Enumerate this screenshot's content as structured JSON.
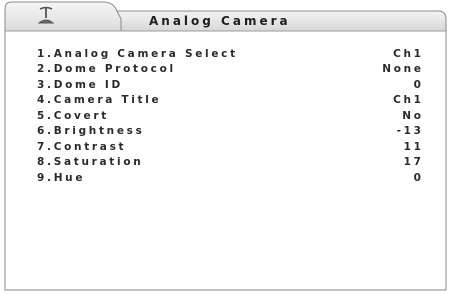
{
  "window": {
    "title": "Analog Camera",
    "icon": "antenna-icon"
  },
  "menu": {
    "items": [
      {
        "label": "1.Analog Camera Select",
        "value": "Ch1"
      },
      {
        "label": "2.Dome Protocol",
        "value": "None"
      },
      {
        "label": "3.Dome ID",
        "value": "0"
      },
      {
        "label": "4.Camera Title",
        "value": "Ch1"
      },
      {
        "label": "5.Covert",
        "value": "No"
      },
      {
        "label": "6.Brightness",
        "value": "-13"
      },
      {
        "label": "7.Contrast",
        "value": "11"
      },
      {
        "label": "8.Saturation",
        "value": "17"
      },
      {
        "label": "9.Hue",
        "value": "0"
      }
    ]
  }
}
